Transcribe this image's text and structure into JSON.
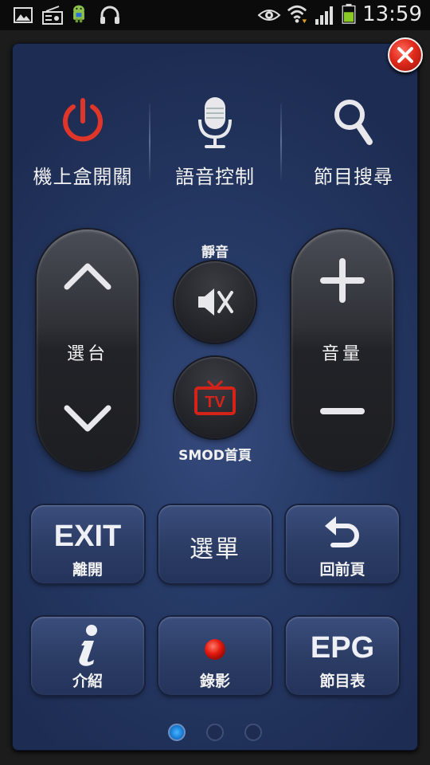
{
  "status_bar": {
    "time": "13:59",
    "icons": [
      "gallery-icon",
      "radio-icon",
      "android-icon",
      "headphones-icon",
      "eye-icon",
      "wifi-icon",
      "signal-icon",
      "battery-icon"
    ]
  },
  "top_functions": [
    {
      "label": "機上盒開關",
      "icon": "power-icon"
    },
    {
      "label": "語音控制",
      "icon": "microphone-icon"
    },
    {
      "label": "節目搜尋",
      "icon": "search-icon"
    }
  ],
  "channel": {
    "label": "選台"
  },
  "volume": {
    "label": "音量"
  },
  "mute": {
    "label": "靜音"
  },
  "smod": {
    "label": "SMOD首頁"
  },
  "buttons": {
    "exit": {
      "big": "EXIT",
      "sub": "離開"
    },
    "menu": {
      "label": "選單"
    },
    "back": {
      "sub": "回前頁"
    },
    "info": {
      "sub": "介紹"
    },
    "record": {
      "sub": "錄影"
    },
    "epg": {
      "big": "EPG",
      "sub": "節目表"
    }
  },
  "pager": {
    "pages": 3,
    "current": 1
  },
  "colors": {
    "accent_red": "#e02a1c",
    "panel": "#263a66",
    "active_dot": "#2a9bf0"
  }
}
